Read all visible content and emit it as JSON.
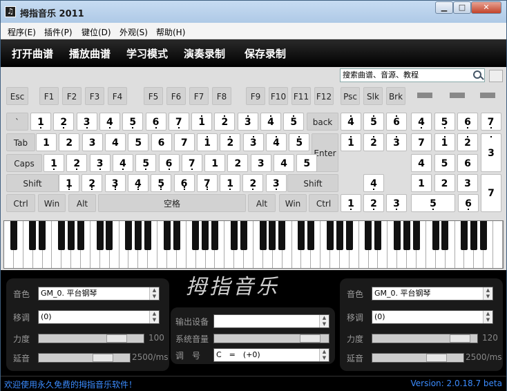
{
  "window": {
    "title": "拇指音乐 2011"
  },
  "menu": [
    "程序(E)",
    "插件(P)",
    "键位(D)",
    "外观(S)",
    "帮助(H)"
  ],
  "toolbar": [
    "打开曲谱",
    "播放曲谱",
    "学习模式",
    "演奏录制",
    "保存录制"
  ],
  "search": {
    "value": "搜索曲谱、音源、教程"
  },
  "fkeys": [
    "Esc",
    "F1",
    "F2",
    "F3",
    "F4",
    "F5",
    "F6",
    "F7",
    "F8",
    "F9",
    "F10",
    "F11",
    "F12",
    "Psc",
    "Slk",
    "Brk"
  ],
  "rows": {
    "num": {
      "lead": "`",
      "notes": [
        "1",
        "2",
        "3",
        "4",
        "5",
        "6",
        "7",
        "1",
        "2",
        "3",
        "4",
        "5"
      ],
      "tail": "back"
    },
    "tab": {
      "lead": "Tab",
      "notes": [
        "1",
        "2",
        "3",
        "4",
        "5",
        "6",
        "7",
        "1",
        "2",
        "3",
        "4",
        "5"
      ],
      "tail": "Enter"
    },
    "caps": {
      "lead": "Caps",
      "notes": [
        "1",
        "2",
        "3",
        "4",
        "5",
        "6",
        "7",
        "1",
        "2",
        "3",
        "4",
        "5"
      ]
    },
    "shift": {
      "lead": "Shift",
      "notes": [
        "1",
        "2",
        "3",
        "4",
        "5",
        "6",
        "7",
        "1",
        "2",
        "3"
      ],
      "tail": "Shift"
    },
    "ctrl": [
      "Ctrl",
      "Win",
      "Alt",
      "空格",
      "Alt",
      "Win",
      "Ctrl"
    ]
  },
  "nav": {
    "ins_row": [
      "4",
      "5",
      "6"
    ],
    "del_row": [
      "1",
      "2",
      "3"
    ],
    "up": "4",
    "bottom": [
      "1",
      "2",
      "3"
    ]
  },
  "numpad": {
    "r1": [
      "4",
      "5",
      "6",
      "7"
    ],
    "r2": [
      "7",
      "1",
      "2"
    ],
    "plus": "3",
    "r3": [
      "4",
      "5",
      "6"
    ],
    "r4": [
      "1",
      "2",
      "3"
    ],
    "enter": "7",
    "zero": "5",
    "dot": "6"
  },
  "left_panel": {
    "voice_label": "音色",
    "voice": "GM_0. 平台钢琴",
    "transpose_label": "移调",
    "transpose": "(0)",
    "force_label": "力度",
    "force": "100",
    "sustain_label": "延音",
    "sustain": "2500/ms"
  },
  "mid_panel": {
    "output_label": "输出设备",
    "output": "",
    "volume_label": "系统音量",
    "key_label": "调　号",
    "key": "C　=　(+0)"
  },
  "right_panel": {
    "voice_label": "音色",
    "voice": "GM_0. 平台钢琴",
    "transpose_label": "移调",
    "transpose": "(0)",
    "force_label": "力度",
    "force": "120",
    "sustain_label": "延音",
    "sustain": "2500/ms"
  },
  "logo": "拇指音乐",
  "status": {
    "welcome": "欢迎使用永久免费的拇指音乐软件！",
    "version": "Version: 2.0.18.7 beta"
  }
}
